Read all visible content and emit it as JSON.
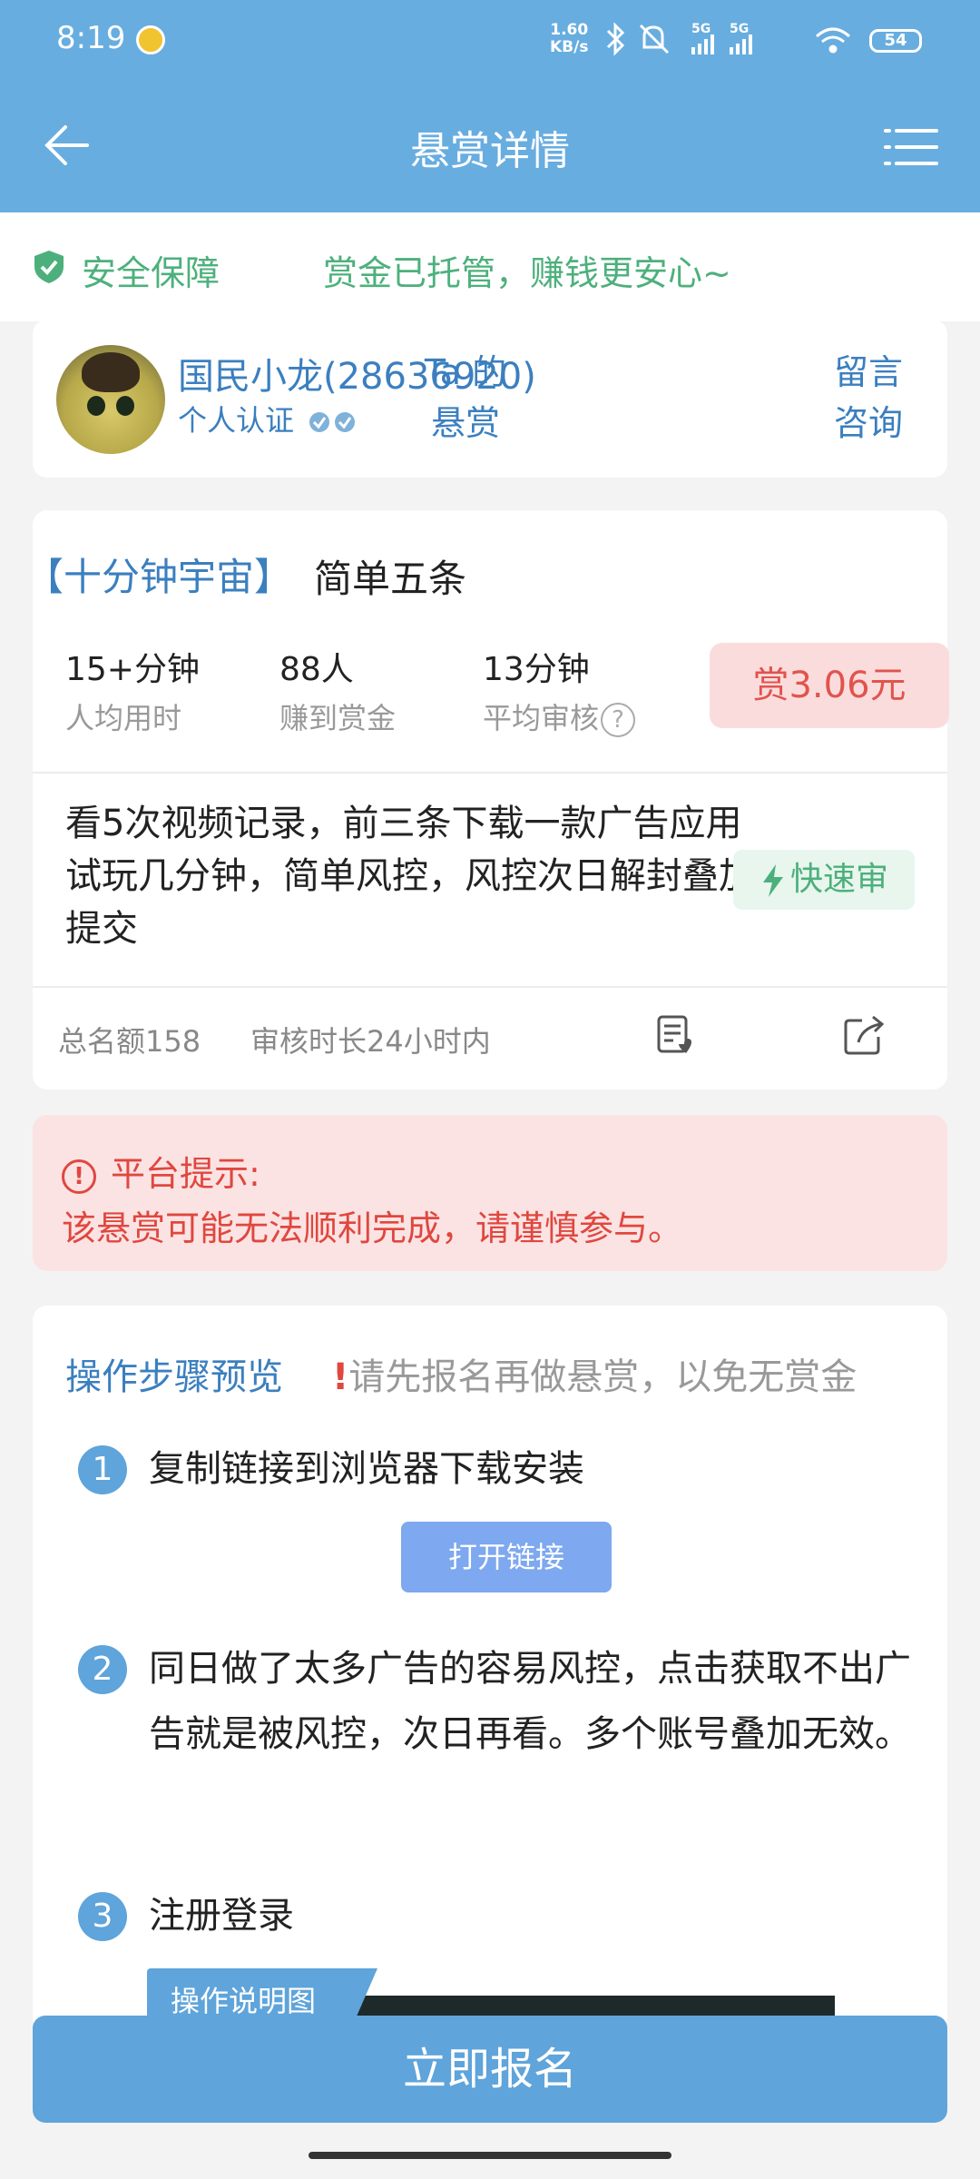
{
  "status_bar": {
    "time": "8:19",
    "net_speed_value": "1.60",
    "net_speed_unit": "KB/s",
    "signal_1": "5G",
    "signal_2": "5G",
    "battery": "54",
    "icons": [
      "app-notification-icon",
      "bluetooth-icon",
      "mute-icon",
      "signal-icon",
      "wifi-icon",
      "battery-icon"
    ]
  },
  "nav": {
    "title": "悬赏详情",
    "back_icon": "back-arrow-icon",
    "menu_icon": "menu-icon"
  },
  "safety": {
    "label": "安全保障",
    "message": "赏金已托管，赚钱更安心~",
    "icon": "shield-check-icon"
  },
  "publisher": {
    "name": "国民小龙(28636920)",
    "certification": "个人认证",
    "their_rewards_line1": "Ta 的",
    "their_rewards_line2": "悬赏",
    "consult_line1": "留言",
    "consult_line2": "咨询"
  },
  "task": {
    "tag": "【十分钟宇宙】",
    "title": "简单五条",
    "stats": [
      {
        "value": "15+分钟",
        "label": "人均用时"
      },
      {
        "value": "88人",
        "label": "赚到赏金"
      },
      {
        "value": "13分钟",
        "label": "平均审核"
      }
    ],
    "help_glyph": "?",
    "reward": "赏3.06元",
    "description": "看5次视频记录，前三条下载一款广告应用试玩几分钟，简单风控，风控次日解封叠加提交",
    "fast_review": "快速审",
    "quota": "总名额158",
    "review_duration": "审核时长24小时内"
  },
  "warning": {
    "title": "平台提示:",
    "text": "该悬赏可能无法顺利完成，请谨慎参与。",
    "icon_glyph": "!"
  },
  "steps": {
    "title": "操作步骤预览",
    "notice_mark": "!",
    "notice": "请先报名再做悬赏，以免无赏金",
    "items": [
      {
        "num": "1",
        "text": "复制链接到浏览器下载安装"
      },
      {
        "num": "2",
        "text": "同日做了太多广告的容易风控，点击获取不出广告就是被风控，次日再看。多个账号叠加无效。"
      },
      {
        "num": "3",
        "text": "注册登录"
      }
    ],
    "open_link": "打开链接",
    "guide_label": "操作说明图"
  },
  "signup_button": "立即报名",
  "colors": {
    "primary": "#68ade0",
    "link": "#3b7fbf",
    "safe_green": "#4db07c",
    "danger": "#e0473f",
    "reward_bg": "#fbdcdc"
  }
}
